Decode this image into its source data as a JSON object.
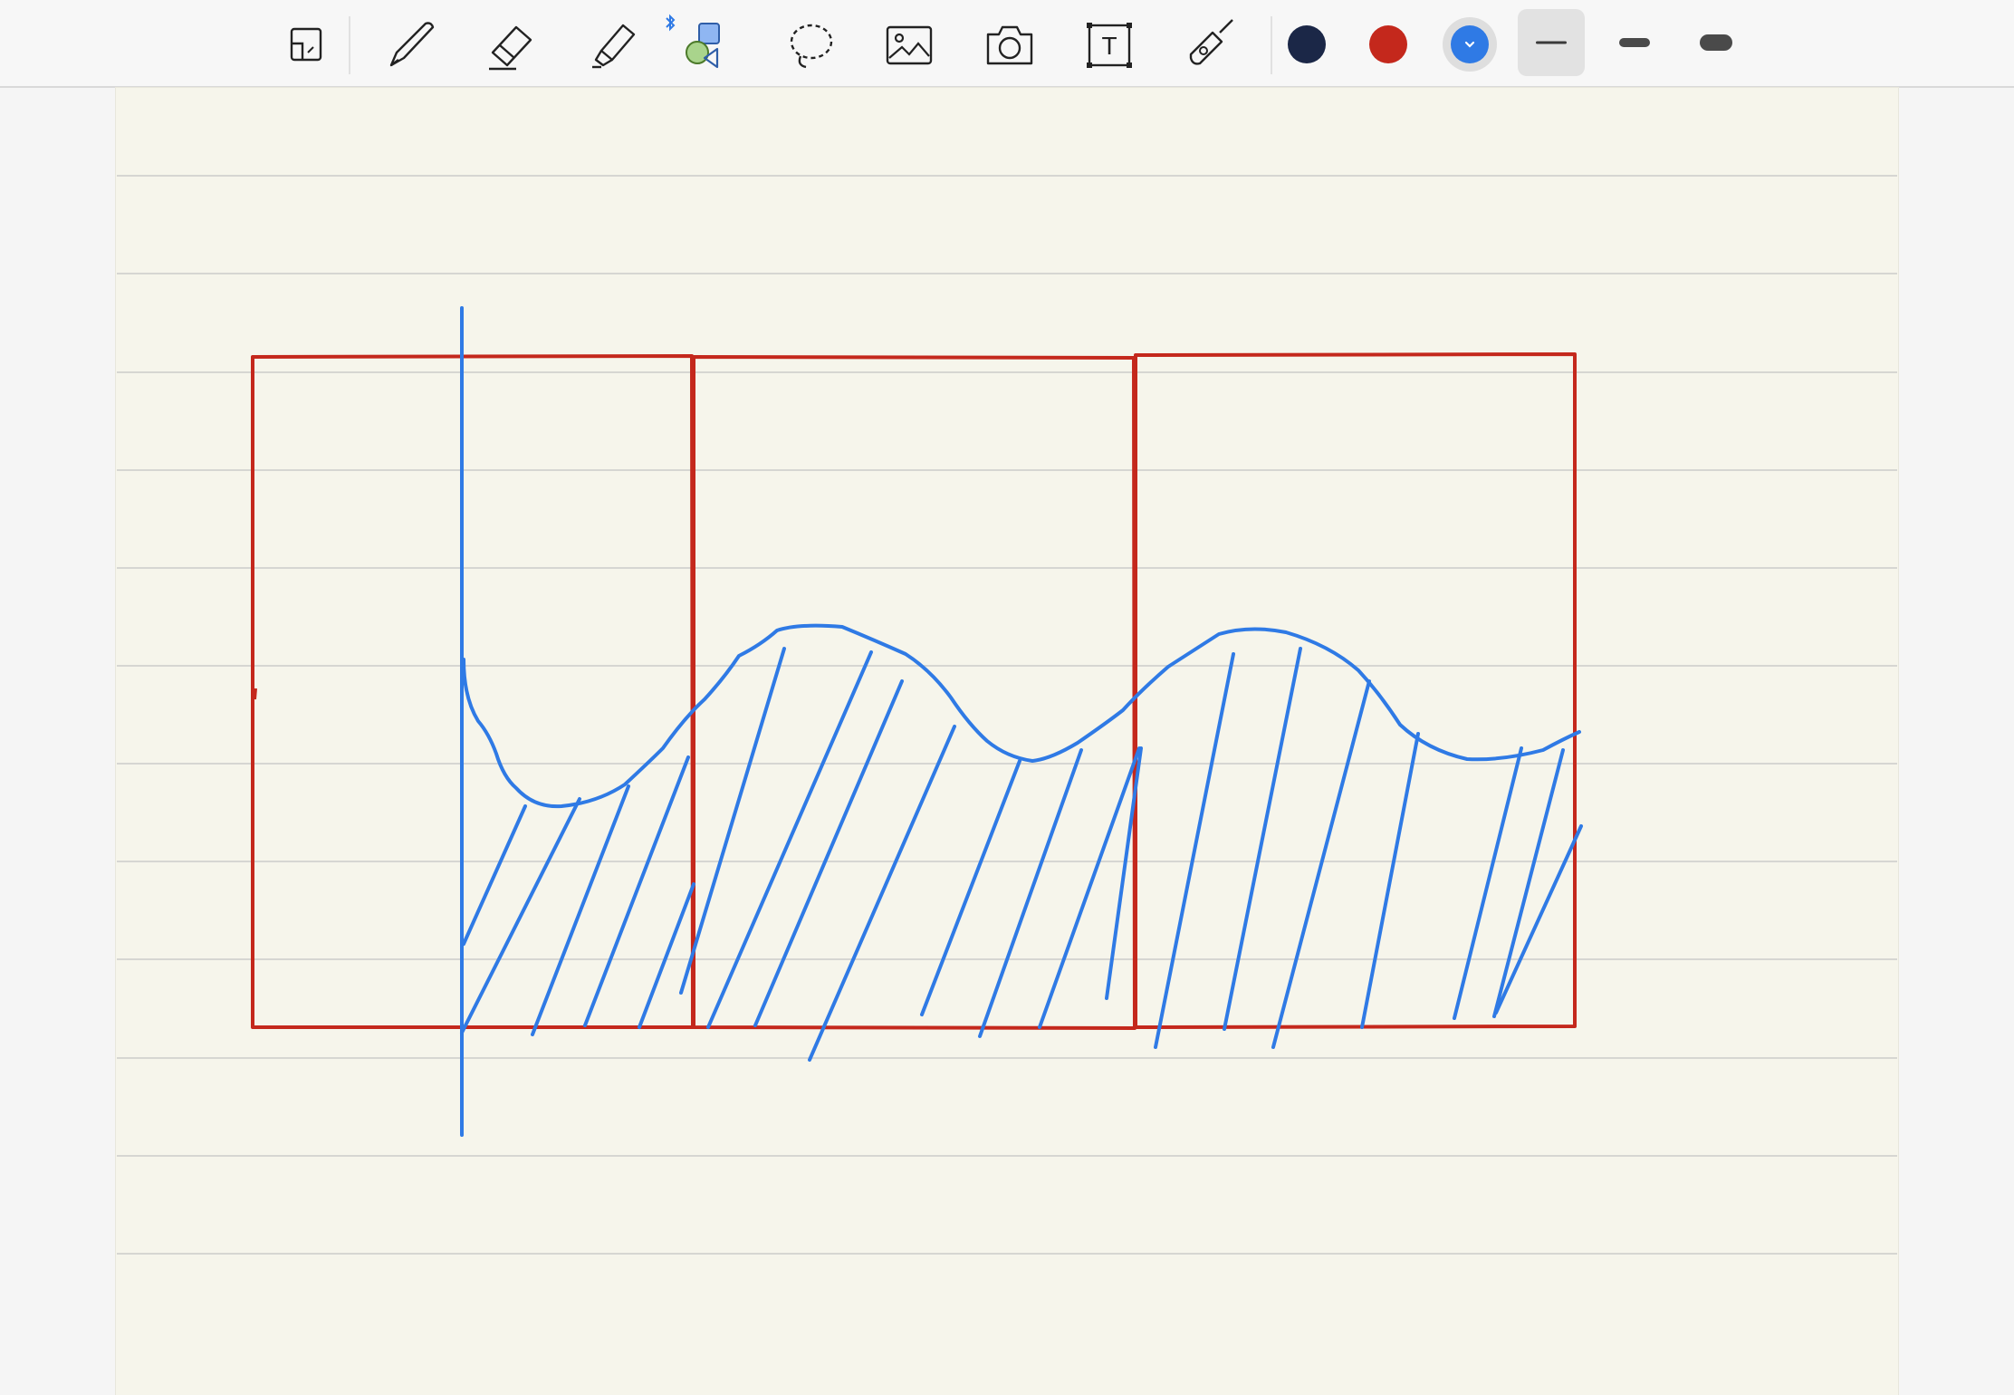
{
  "toolbar": {
    "tools": [
      {
        "id": "page-layout",
        "icon": "page-layout-icon"
      },
      {
        "id": "pen",
        "icon": "pen-icon"
      },
      {
        "id": "eraser",
        "icon": "eraser-icon"
      },
      {
        "id": "highlighter",
        "icon": "highlighter-icon"
      },
      {
        "id": "shapes",
        "icon": "shapes-icon"
      },
      {
        "id": "lasso",
        "icon": "lasso-icon"
      },
      {
        "id": "image",
        "icon": "image-icon"
      },
      {
        "id": "camera",
        "icon": "camera-icon"
      },
      {
        "id": "text",
        "icon": "text-box-icon"
      },
      {
        "id": "laser-pointer",
        "icon": "laser-pointer-icon"
      }
    ],
    "bluetooth_icon": "bluetooth-icon",
    "text_tool_glyph": "T",
    "colors": [
      {
        "name": "navy",
        "hex": "#1b2747",
        "selected": false
      },
      {
        "name": "red",
        "hex": "#c4281c",
        "selected": false
      },
      {
        "name": "blue",
        "hex": "#2f7ae5",
        "selected": true
      }
    ],
    "widths": [
      {
        "name": "thin",
        "selected": true
      },
      {
        "name": "medium",
        "selected": false
      },
      {
        "name": "thick",
        "selected": false
      }
    ]
  },
  "page": {
    "background": "#f6f5eb",
    "rule_color": "#d6d6d2"
  },
  "ink": {
    "box_color": "#c4281c",
    "curve_color": "#2f7ae5"
  }
}
